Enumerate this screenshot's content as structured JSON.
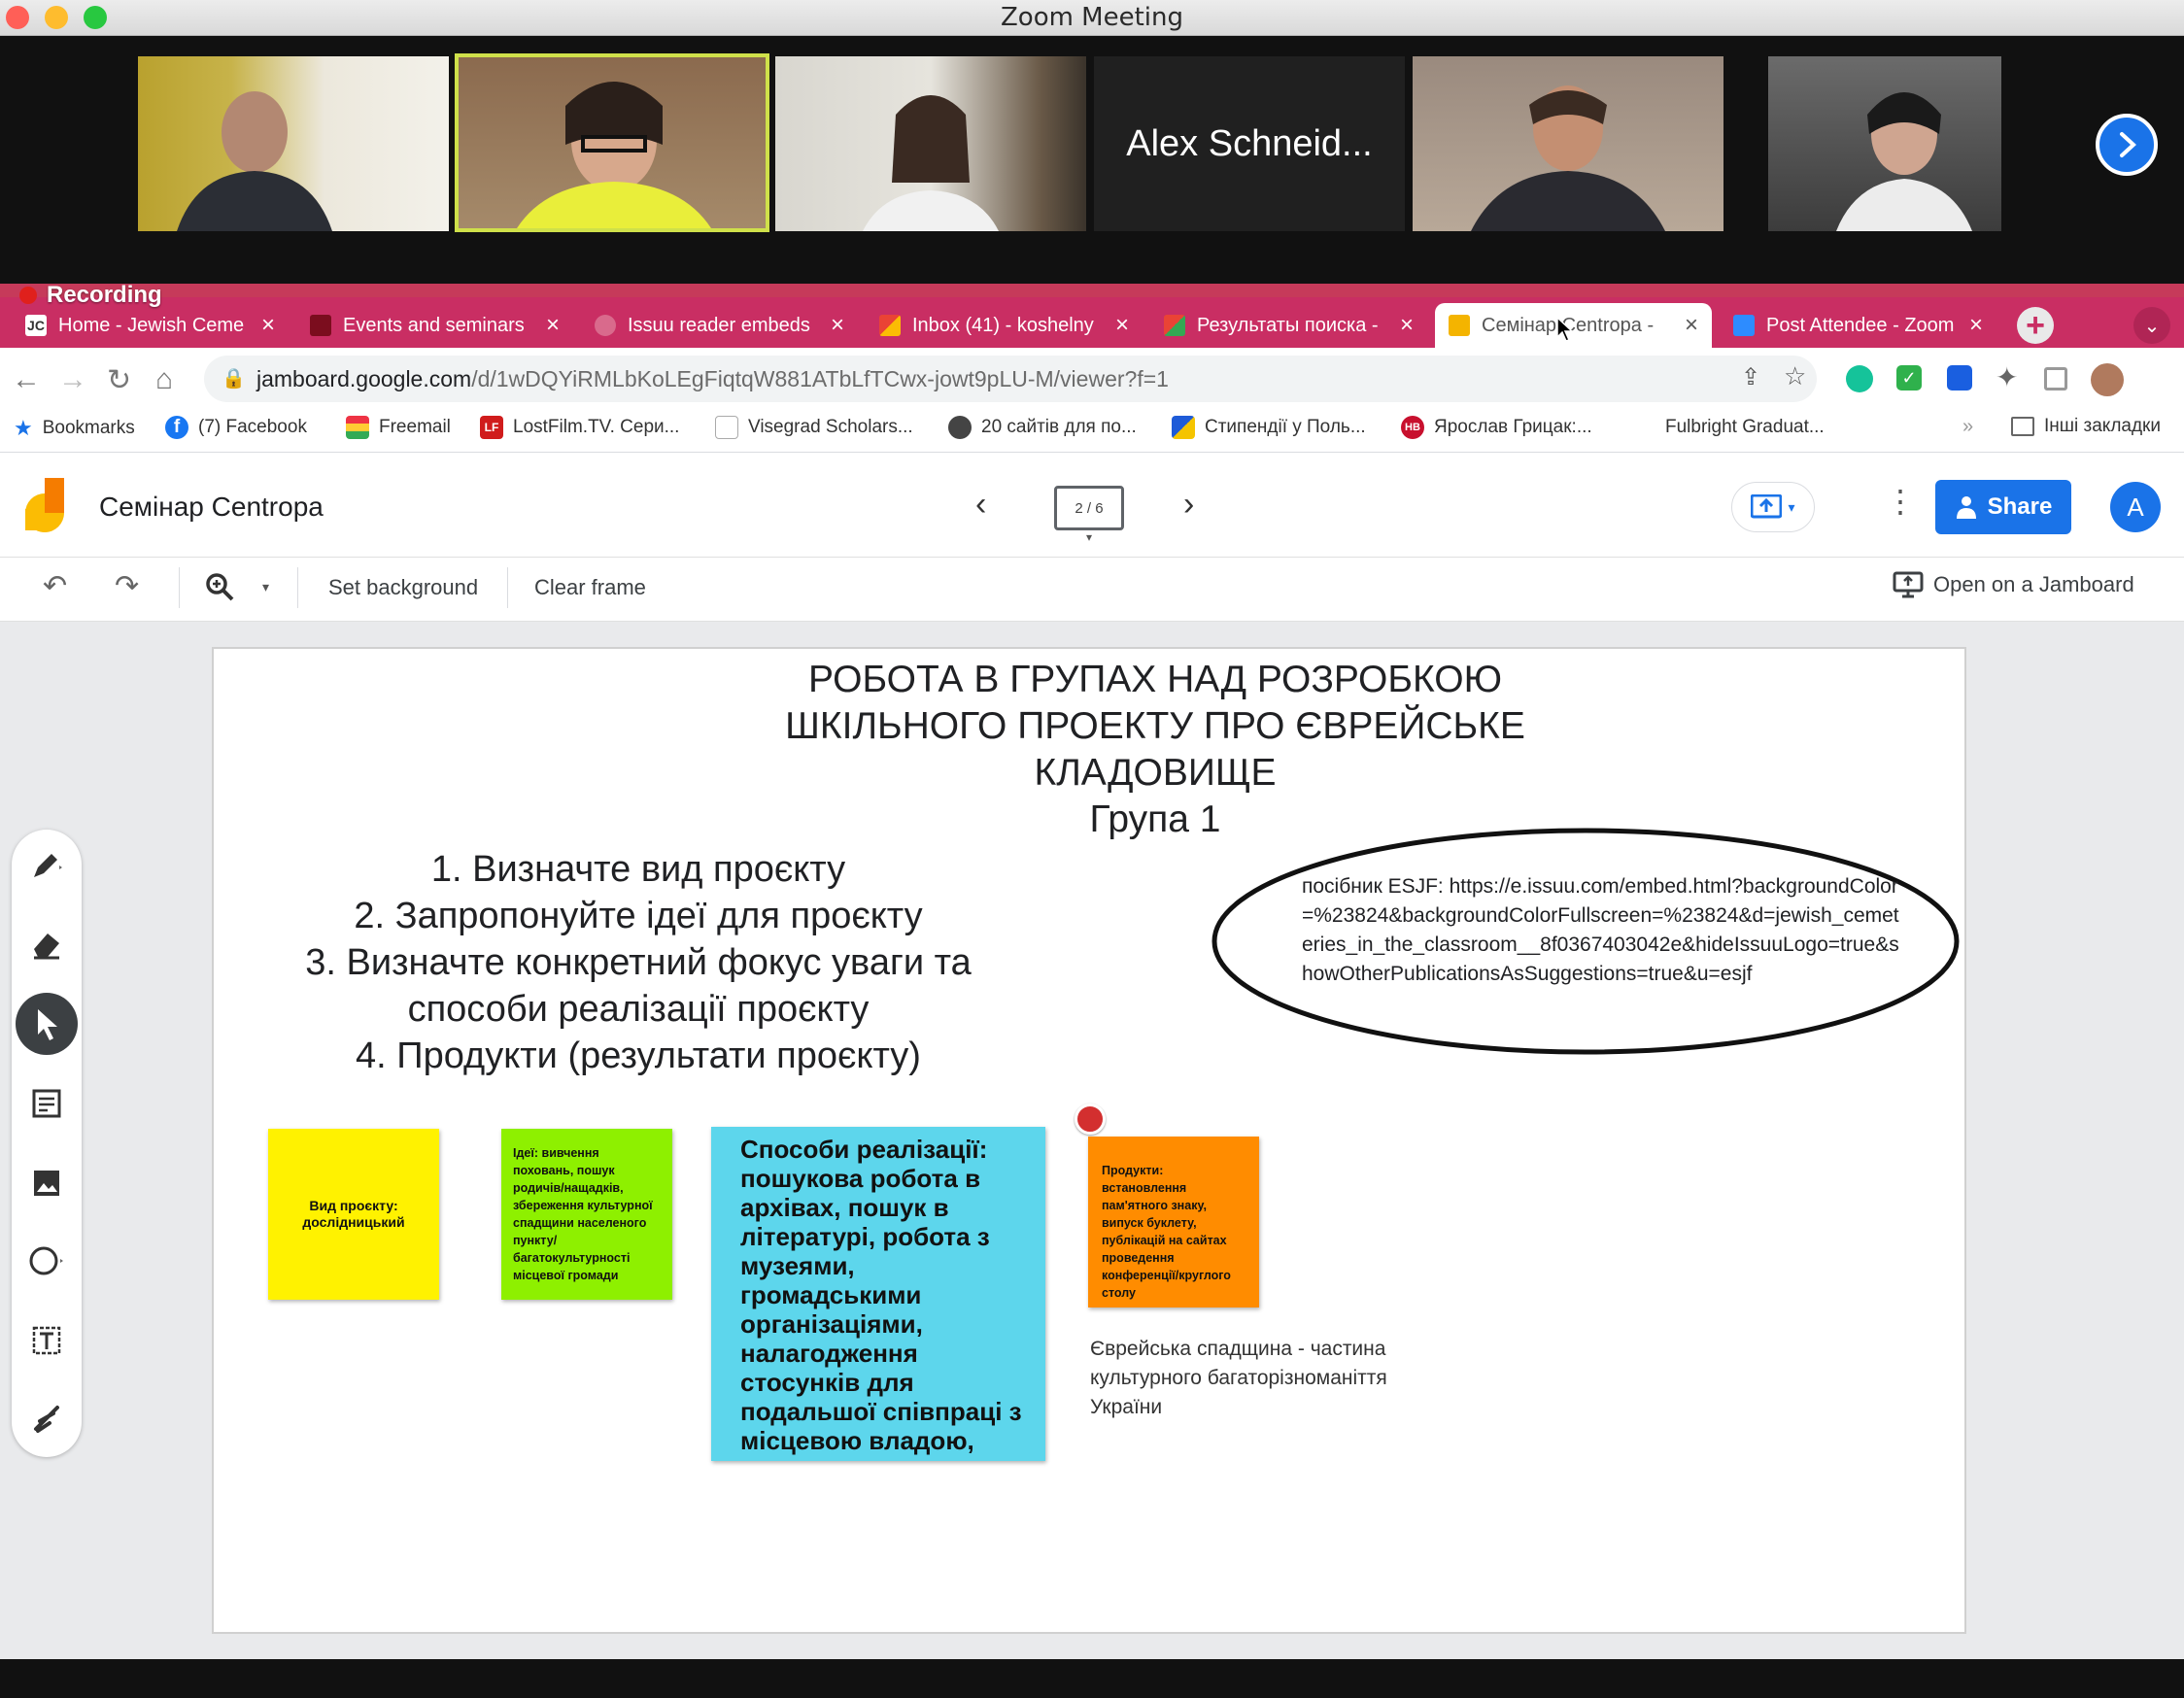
{
  "zoom": {
    "window_title": "Zoom Meeting",
    "participants": [
      {
        "kind": "video"
      },
      {
        "kind": "video",
        "active_speaker": true
      },
      {
        "kind": "video"
      },
      {
        "kind": "name",
        "name": "Alex Schneid..."
      },
      {
        "kind": "video"
      },
      {
        "kind": "video"
      }
    ],
    "recording_label": "Recording"
  },
  "browser": {
    "tabs": [
      {
        "label": "Home - Jewish Ceme",
        "active": false
      },
      {
        "label": "Events and seminars",
        "active": false
      },
      {
        "label": "Issuu reader embeds",
        "active": false
      },
      {
        "label": "Inbox (41) - koshelny",
        "active": false
      },
      {
        "label": "Результаты поиска -",
        "active": false
      },
      {
        "label": "Семінар Centropa -",
        "active": true
      },
      {
        "label": "Post Attendee - Zoom",
        "active": false
      }
    ],
    "url_host": "jamboard.google.com",
    "url_path": "/d/1wDQYiRMLbKoLEgFiqtqW881ATbLfTCwx-jowt9pLU-M/viewer?f=1",
    "bookmarks": [
      "Bookmarks",
      "(7) Facebook",
      "Freemail",
      "LostFilm.TV. Сери...",
      "Visegrad Scholars...",
      "20 сайтів для по...",
      "Стипендії у Поль...",
      "Ярослав Грицак:...",
      "Fulbright Graduat...",
      "Інші закладки"
    ]
  },
  "jamboard": {
    "title": "Семінар Centropa",
    "frame_counter": "2 / 6",
    "share_label": "Share",
    "avatar_initial": "A",
    "toolbar": {
      "set_background": "Set background",
      "clear_frame": "Clear frame",
      "open_on_jamboard": "Open on a Jamboard"
    },
    "frame": {
      "heading_lines": [
        "РОБОТА В ГРУПАХ НАД РОЗРОБКОЮ",
        "ШКІЛЬНОГО ПРОЕКТУ ПРО ЄВРЕЙСЬКЕ",
        "КЛАДОВИЩЕ",
        "Група 1"
      ],
      "tasks": [
        "1. Визначте вид проєкту",
        "2. Запропонуйте ідеї для проєкту",
        "3. Визначте конкретний фокус уваги та",
        "способи реалізації проєкту",
        "4. Продукти (результати проєкту)"
      ],
      "ellipse_text": "посібник ESJF: https://e.issuu.com/embed.html?backgroundColor=%23824&backgroundColorFullscreen=%23824&d=jewish_cemeteries_in_the_classroom__8f0367403042e&hideIssuuLogo=true&showOtherPublicationsAsSuggestions=true&u=esjf",
      "notes": {
        "type": "Вид проєкту: дослідницький",
        "ideas": "Ідеї: вивчення поховань, пошук родичів/нащадків, збереження культурної спадщини населеного пункту/багатокультурності місцевої громади",
        "methods": "Способи реалізації: пошукова робота в архівах, пошук в літературі, робота з музеями, громадськими організаціями, налагодження стосунків для подальшої співпраці з місцевою владою,",
        "products": "Продукти: встановлення пам'ятного знаку, випуск буклету, публікацій на сайтах проведення конференції/круглого столу"
      },
      "caption": "Єврейська спадщина - частина культурного багаторізноманіття України"
    }
  },
  "colors": {
    "note_yellow": "#fff200",
    "note_green": "#8ef000",
    "note_cyan": "#5dd6ec",
    "note_orange": "#ff8c00",
    "share_blue": "#1a73e8",
    "tab_bar": "#c92e63"
  }
}
